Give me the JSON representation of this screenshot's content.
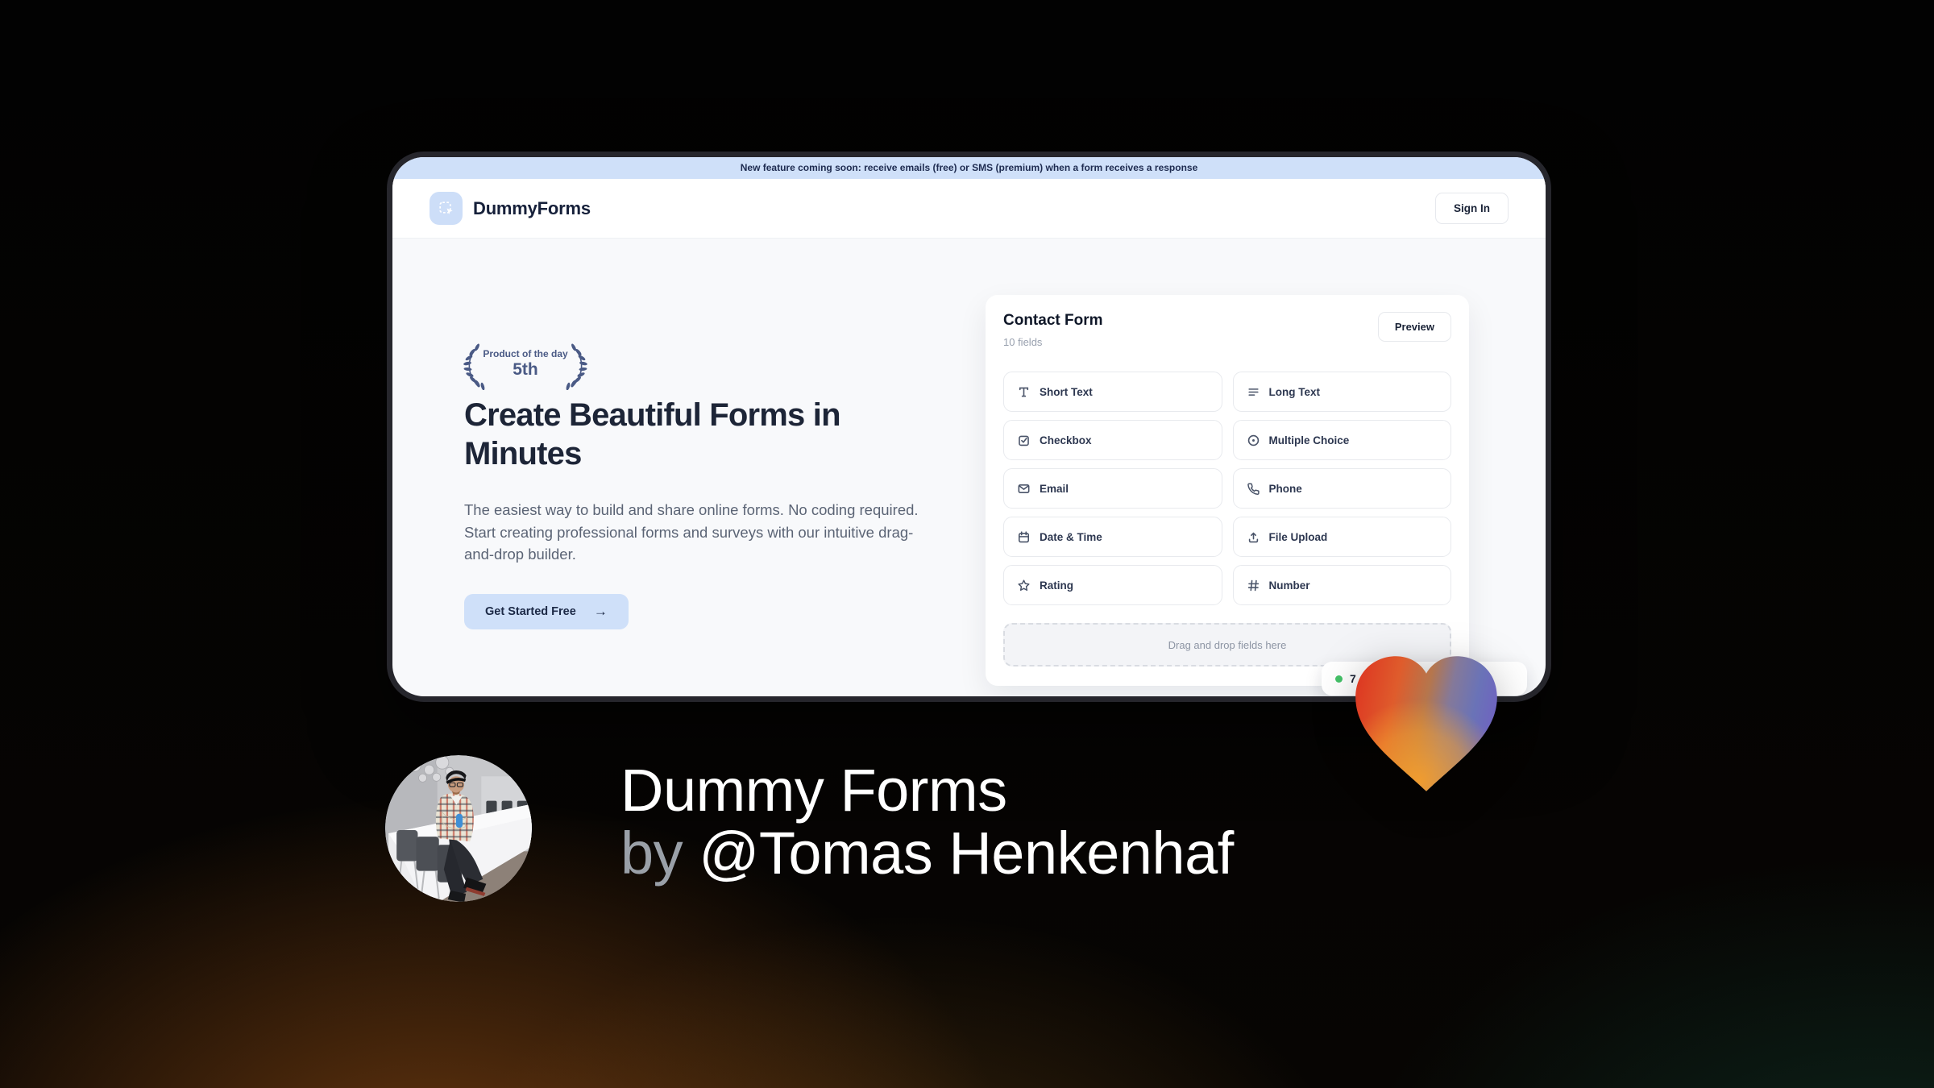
{
  "theme": {
    "accent_blue": "#cfe0f9",
    "navy": "#1d2537",
    "slate_text": "#5b6475",
    "laurel_color": "#4a5a85",
    "green_dot": "#44c268",
    "card_bg": "#ffffff",
    "page_light_bg": "#f8f9fb"
  },
  "banner": {
    "text": "New feature coming soon: receive emails (free) or SMS (premium) when a form receives a response"
  },
  "header": {
    "brand": "DummyForms",
    "sign_in": "Sign In"
  },
  "hero": {
    "laurel_line1": "Product of the day",
    "laurel_line2": "5th",
    "title": "Create Beautiful Forms in\nMinutes",
    "description": "The easiest way to build and share online forms. No coding required.\nStart creating professional forms and surveys with our intuitive drag-\nand-drop builder.",
    "cta": "Get Started Free",
    "cta_arrow": "→"
  },
  "form_builder": {
    "title": "Contact Form",
    "subtitle": "10 fields",
    "preview": "Preview",
    "fields": [
      {
        "label": "Short Text",
        "icon": "type-icon"
      },
      {
        "label": "Long Text",
        "icon": "align-left-icon"
      },
      {
        "label": "Checkbox",
        "icon": "checkbox-icon"
      },
      {
        "label": "Multiple Choice",
        "icon": "radio-icon"
      },
      {
        "label": "Email",
        "icon": "envelope-icon"
      },
      {
        "label": "Phone",
        "icon": "phone-icon"
      },
      {
        "label": "Date & Time",
        "icon": "calendar-icon"
      },
      {
        "label": "File Upload",
        "icon": "upload-icon"
      },
      {
        "label": "Rating",
        "icon": "star-icon"
      },
      {
        "label": "Number",
        "icon": "hash-icon"
      }
    ],
    "dropzone_text": "Drag and drop fields here",
    "live_badge": {
      "text": "7"
    }
  },
  "heart": {
    "gradient": [
      "#dd3822",
      "#df5c2c",
      "#b5764d",
      "#84799a",
      "#6a73b7",
      "#6f63c0"
    ],
    "glow_orange": "#f49e2c"
  },
  "footer": {
    "title": "Dummy Forms",
    "byline_prefix": "by ",
    "byline_handle": "@Tomas Henkenhaf"
  }
}
